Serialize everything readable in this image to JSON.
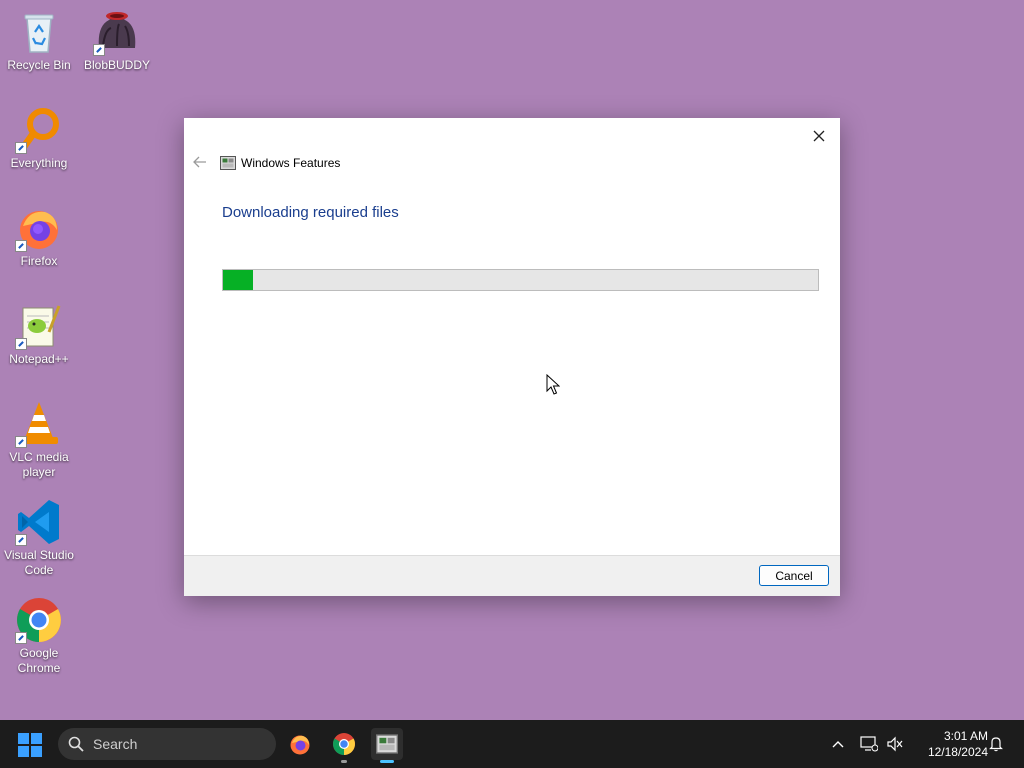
{
  "desktop": {
    "icons": [
      {
        "label": "Recycle Bin"
      },
      {
        "label": "BlobBUDDY"
      },
      {
        "label": "Everything"
      },
      {
        "label": "Firefox"
      },
      {
        "label": "Notepad++"
      },
      {
        "label": "VLC media player"
      },
      {
        "label": "Visual Studio Code"
      },
      {
        "label": "Google Chrome"
      }
    ]
  },
  "dialog": {
    "title": "Windows Features",
    "heading": "Downloading required files",
    "progress_fraction": 0.05,
    "cancel_label": "Cancel"
  },
  "taskbar": {
    "search_placeholder": "Search",
    "time": "3:01 AM",
    "date": "12/18/2024"
  },
  "colors": {
    "desktop_bg": "#ac82b6",
    "progress_fill": "#06b025",
    "heading": "#1a3e8e",
    "accent": "#0067c0"
  }
}
